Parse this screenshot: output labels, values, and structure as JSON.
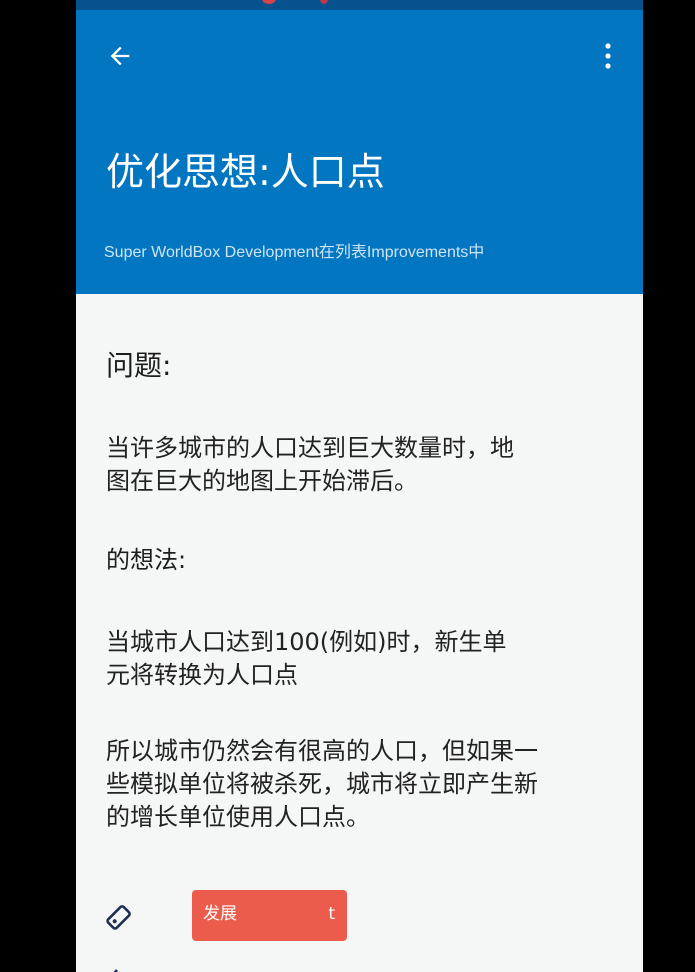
{
  "appbar": {
    "title": "优化思想:人口点",
    "subtitle": "Super WorldBox Development在列表Improvements中",
    "back_icon": "arrow-left-icon",
    "more_icon": "more-vertical-icon"
  },
  "content": {
    "problem_heading": "问题:",
    "problem_text_1": "当许多城市的人口达到巨大数量时，地",
    "problem_text_2": "图在巨大的地图上开始滞后。",
    "idea_heading": "的想法:",
    "idea_text_1": "当城市人口达到100(例如)时，新生单",
    "idea_text_2": "元将转换为人口点",
    "result_text_1": "所以城市仍然会有很高的人口，但如果一",
    "result_text_2": "些模拟单位将被杀死，城市将立即产生新",
    "result_text_3": "的增长单位使用人口点。"
  },
  "tags": {
    "icon": "tag-icon",
    "label": "发展",
    "label_suffix": "t"
  },
  "colors": {
    "appbar": "#0276c0",
    "status_bar": "#05528f",
    "background": "#f5f6f6",
    "tag_chip": "#ec5c4c",
    "text": "#222222"
  }
}
